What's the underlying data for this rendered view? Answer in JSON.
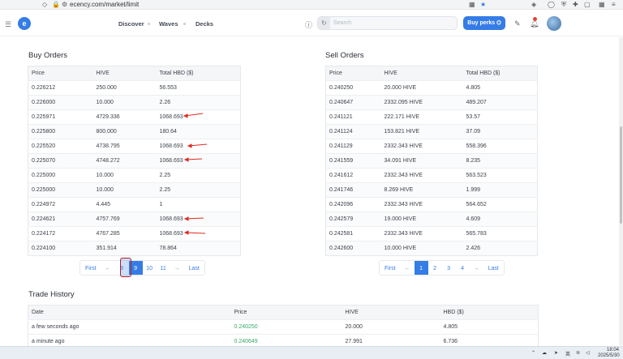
{
  "browser": {
    "url": "ecency.com/market/limit"
  },
  "header": {
    "nav": [
      "Discover",
      "Waves",
      "Decks"
    ],
    "search_placeholder": "Search",
    "buy_perks": "Buy perks",
    "accent": "#357ce6"
  },
  "buy": {
    "title": "Buy Orders",
    "headers": [
      "Price",
      "HIVE",
      "Total HBD ($)"
    ],
    "rows": [
      [
        "0.226212",
        "250.000",
        "56.553"
      ],
      [
        "0.226000",
        "10.000",
        "2.26"
      ],
      [
        "0.225971",
        "4729.336",
        "1068.693"
      ],
      [
        "0.225800",
        "800.000",
        "180.64"
      ],
      [
        "0.225520",
        "4738.795",
        "1068.693"
      ],
      [
        "0.225070",
        "4748.272",
        "1068.693"
      ],
      [
        "0.225000",
        "10.000",
        "2.25"
      ],
      [
        "0.225000",
        "10.000",
        "2.25"
      ],
      [
        "0.224972",
        "4.445",
        "1"
      ],
      [
        "0.224621",
        "4757.769",
        "1068.693"
      ],
      [
        "0.224172",
        "4767.285",
        "1068.693"
      ],
      [
        "0.224100",
        "351.914",
        "78.864"
      ]
    ],
    "pager": [
      "First",
      "←",
      "8",
      "9",
      "10",
      "11",
      "→",
      "Last"
    ]
  },
  "sell": {
    "title": "Sell Orders",
    "headers": [
      "Price",
      "HIVE",
      "Total HBD ($)"
    ],
    "rows": [
      [
        "0.240250",
        "20.000 HIVE",
        "4.805"
      ],
      [
        "0.240647",
        "2332.095 HIVE",
        "489.207"
      ],
      [
        "0.241121",
        "222.171 HIVE",
        "53.57"
      ],
      [
        "0.241124",
        "153.821 HIVE",
        "37.09"
      ],
      [
        "0.241129",
        "2332.343 HIVE",
        "558.396"
      ],
      [
        "0.241559",
        "34.091 HIVE",
        "8.235"
      ],
      [
        "0.241612",
        "2332.343 HIVE",
        "563.523"
      ],
      [
        "0.241746",
        "8.269 HIVE",
        "1.999"
      ],
      [
        "0.242096",
        "2332.343 HIVE",
        "564.652"
      ],
      [
        "0.242579",
        "19.000 HIVE",
        "4.609"
      ],
      [
        "0.242581",
        "2332.343 HIVE",
        "565.783"
      ],
      [
        "0.242600",
        "10.000 HIVE",
        "2.426"
      ]
    ],
    "pager": [
      "First",
      "←",
      "1",
      "2",
      "3",
      "4",
      "→",
      "Last"
    ]
  },
  "history": {
    "title": "Trade History",
    "headers": [
      "Date",
      "Price",
      "HIVE",
      "HBD ($)"
    ],
    "rows": [
      [
        "a few seconds ago",
        "0.240250",
        "20.000",
        "4.805"
      ],
      [
        "a minute ago",
        "0.240649",
        "27.991",
        "6.736"
      ]
    ]
  },
  "taskbar": {
    "lang": "英",
    "time": "18:04",
    "date": "2025/5/30"
  }
}
